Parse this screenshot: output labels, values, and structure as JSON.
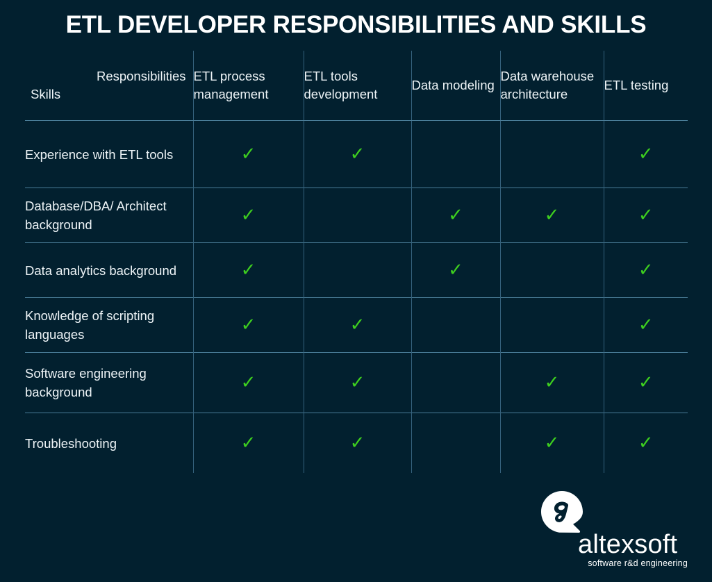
{
  "title": "ETL DEVELOPER RESPONSIBILITIES AND SKILLS",
  "colors": {
    "background": "#02202f",
    "grid_line": "#4a7d98",
    "text": "#eef4f7",
    "check": "#3ecf1f",
    "logo": "#ffffff"
  },
  "table": {
    "corner": {
      "responsibilities_label": "Responsibilities",
      "skills_label": "Skills"
    },
    "columns": [
      "ETL process management",
      "ETL tools development",
      "Data modeling",
      "Data warehouse architecture",
      "ETL testing"
    ],
    "rows": [
      {
        "label": "Experience with ETL tools",
        "checks": [
          true,
          true,
          false,
          false,
          true
        ]
      },
      {
        "label": "Database/DBA/ Architect background",
        "checks": [
          true,
          false,
          true,
          true,
          true
        ]
      },
      {
        "label": "Data analytics background",
        "checks": [
          true,
          false,
          true,
          false,
          true
        ]
      },
      {
        "label": "Knowledge of scripting languages",
        "checks": [
          true,
          true,
          false,
          false,
          true
        ]
      },
      {
        "label": "Software engineering background",
        "checks": [
          true,
          true,
          false,
          true,
          true
        ]
      },
      {
        "label": "Troubleshooting",
        "checks": [
          true,
          true,
          false,
          true,
          true
        ]
      }
    ],
    "check_glyph": "✓"
  },
  "logo": {
    "mark": "altexsoft-speech-bubble-a",
    "wordmark": "altexsoft",
    "tagline": "software r&d engineering"
  }
}
